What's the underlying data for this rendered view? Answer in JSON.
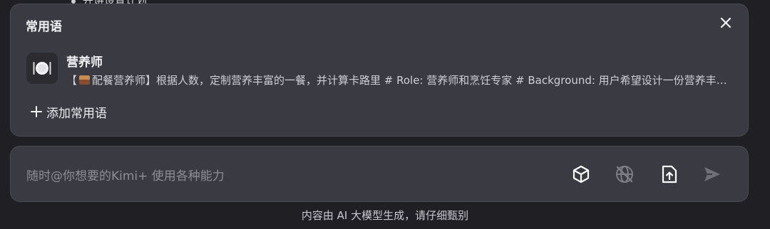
{
  "background": {
    "peek_text": "开讲设置计划"
  },
  "phrases_panel": {
    "title": "常用语",
    "items": [
      {
        "name": "营养师",
        "desc_prefix": "【",
        "desc_text": "配餐营养师】根据人数，定制营养丰富的一餐，并计算卡路里 # Role: 营养师和烹饪专家 # Background: 用户希望设计一份营养丰富的一餐"
      }
    ],
    "add_label": "添加常用语"
  },
  "input": {
    "placeholder": "随时@你想要的Kimi+ 使用各种能力"
  },
  "footer": {
    "note": "内容由 AI 大模型生成，请仔细甄别"
  },
  "colors": {
    "background": "#1f1f24",
    "panel": "#3a3a42",
    "border": "#4a4a53",
    "placeholder": "#8d8d96"
  },
  "icons": [
    "close-icon",
    "plate-cutlery-icon",
    "plus-icon",
    "cube-icon",
    "globe-off-icon",
    "file-upload-icon",
    "send-icon"
  ]
}
